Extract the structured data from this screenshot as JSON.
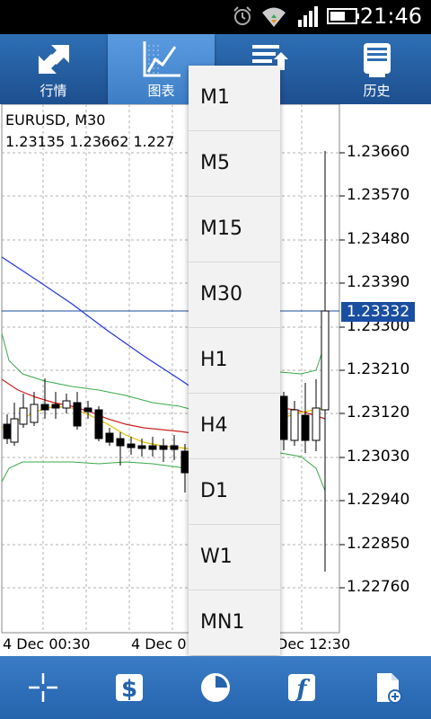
{
  "status": {
    "time": "21:46"
  },
  "tabs": [
    {
      "label": "行情"
    },
    {
      "label": "图表"
    },
    {
      "label": ""
    },
    {
      "label": "历史"
    }
  ],
  "chart": {
    "symbol": "EURUSD, M30",
    "ohlc": "1.23135 1.23662 1.227",
    "current_price": "1.23332",
    "y_ticks": [
      "1.23660",
      "1.23570",
      "1.23480",
      "1.23390",
      "1.23300",
      "1.23210",
      "1.23120",
      "1.23030",
      "1.22940",
      "1.22850",
      "1.22760"
    ],
    "x_ticks": [
      "4 Dec 00:30",
      "4 Dec 0",
      "Dec 12:30"
    ]
  },
  "timeframes": [
    "M1",
    "M5",
    "M15",
    "M30",
    "H1",
    "H4",
    "D1",
    "W1",
    "MN1"
  ],
  "bottom_icons": [
    "crosshair-icon",
    "dollar-icon",
    "period-clock-icon",
    "indicator-f-icon",
    "new-document-icon"
  ]
}
